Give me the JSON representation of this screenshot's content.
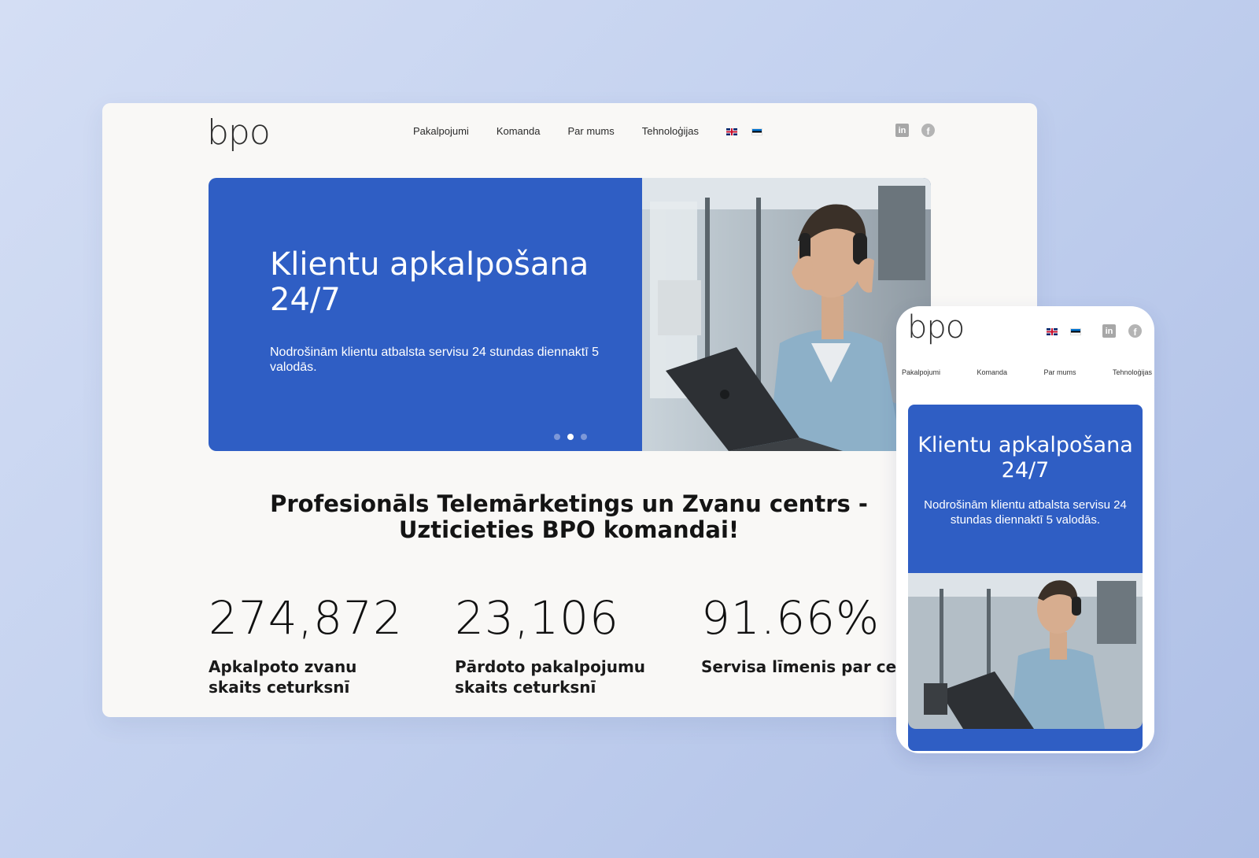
{
  "brand": {
    "logo_text": "bpo"
  },
  "nav": {
    "items": [
      {
        "label": "Pakalpojumi"
      },
      {
        "label": "Komanda"
      },
      {
        "label": "Par mums"
      },
      {
        "label": "Tehnoloģijas"
      }
    ],
    "languages": [
      "flag-uk-icon",
      "flag-ee-icon"
    ],
    "social": {
      "linkedin_glyph": "in",
      "facebook_glyph": "f"
    }
  },
  "hero": {
    "title": "Klientu apkalpošana 24/7",
    "subtitle": "Nodrošinām klientu atbalsta servisu 24 stundas diennaktī 5 valodās.",
    "slides_total": 3,
    "active_slide": 2
  },
  "section": {
    "heading": "Profesionāls Telemārketings un Zvanu centrs - Uzticieties BPO komandai!"
  },
  "stats": [
    {
      "value": "274,872",
      "label": "Apkalpoto zvanu skaits ceturksnī"
    },
    {
      "value": "23,106",
      "label": "Pārdoto pakalpojumu skaits ceturksnī"
    },
    {
      "value": "91.66%",
      "label": "Servisa līmenis par ceturksni"
    }
  ],
  "colors": {
    "brand_blue": "#2f5ec4",
    "page_bg": "#f9f8f6",
    "backdrop": "#c3d1ef"
  }
}
